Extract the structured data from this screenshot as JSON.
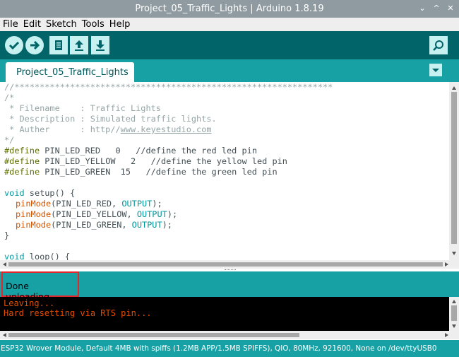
{
  "window": {
    "title": "Project_05_Traffic_Lights | Arduino 1.8.19",
    "minimize": "⌄",
    "maximize": "^",
    "close": "✕"
  },
  "menu": [
    "File",
    "Edit",
    "Sketch",
    "Tools",
    "Help"
  ],
  "toolbar": {
    "verify": "verify-icon",
    "upload": "upload-icon",
    "new": "new-icon",
    "open": "open-icon",
    "save": "save-icon",
    "serial_monitor": "serial-monitor-icon"
  },
  "tab": {
    "label": "Project_05_Traffic_Lights"
  },
  "code": {
    "l1": "//***************************************************************",
    "l2": "/*",
    "l3a": " * Filename    : Traffic Lights",
    "l4a": " * Description : Simulated traffic lights.",
    "l5a": " * Auther      : http//",
    "l5link": "www.keyestudio.com",
    "l6": "*/",
    "d1k": "#define",
    "d1n": " PIN_LED_RED   ",
    "d1v": "0",
    "d1c": "   //define the red led pin",
    "d2k": "#define",
    "d2n": " PIN_LED_YELLOW   ",
    "d2v": "2",
    "d2c": "   //define the yellow led pin",
    "d3k": "#define",
    "d3n": " PIN_LED_GREEN  ",
    "d3v": "15",
    "d3c": "   //define the green led pin",
    "s1k": "void",
    "s1f": " setup",
    "s1p": "() {",
    "p1f": "pinMode",
    "p1a": "(PIN_LED_RED, ",
    "p1c": "OUTPUT",
    "p1e": ");",
    "p2f": "pinMode",
    "p2a": "(PIN_LED_YELLOW, ",
    "p2c": "OUTPUT",
    "p2e": ");",
    "p3f": "pinMode",
    "p3a": "(PIN_LED_GREEN, ",
    "p3c": "OUTPUT",
    "p3e": ");",
    "cb": "}",
    "lk": "void",
    "lf": " loop",
    "lp": "() {"
  },
  "status": {
    "message": "Done uploading."
  },
  "console": {
    "line1": "Leaving...",
    "line2": "Hard resetting via RTS pin..."
  },
  "footer": {
    "board": "ESP32 Wrover Module, Default 4MB with spiffs (1.2MB APP/1.5MB SPIFFS), QIO, 80MHz, 921600, None on /dev/ttyUSB0"
  },
  "colors": {
    "teal_dark": "#006468",
    "teal": "#17a1a5",
    "highlight": "#e3252c",
    "console_text": "#e34c00"
  }
}
